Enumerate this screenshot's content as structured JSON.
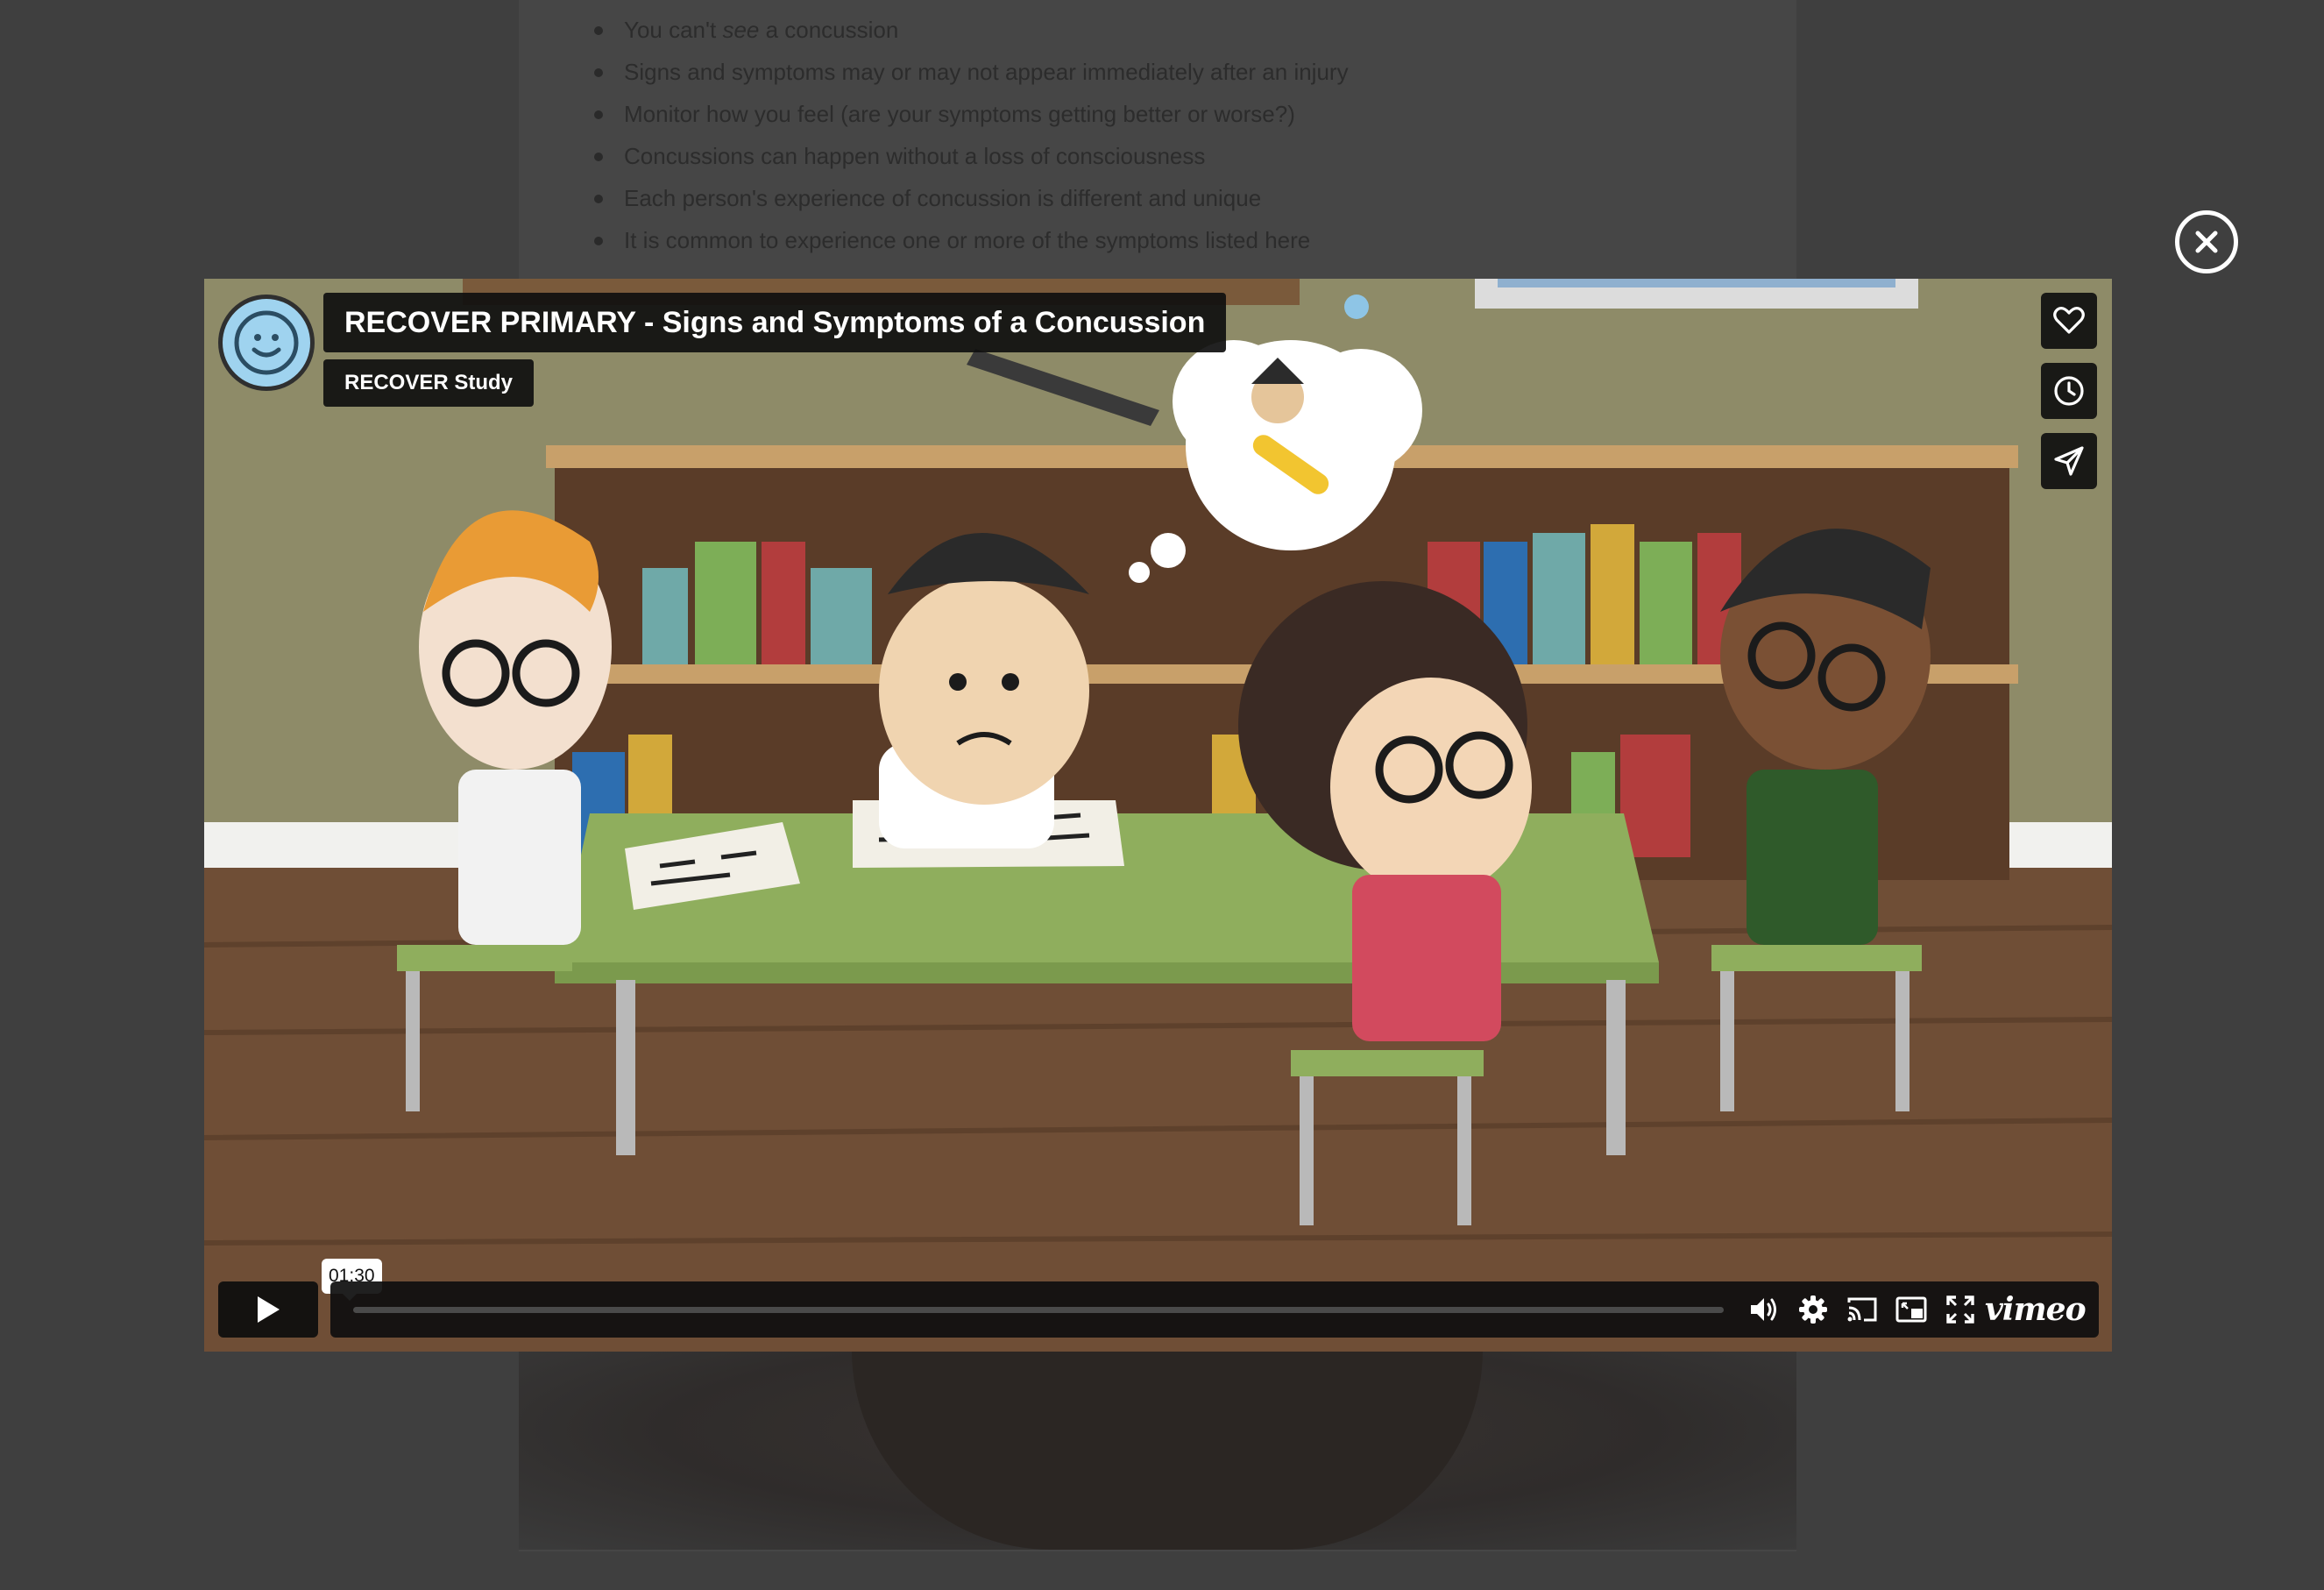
{
  "background_page": {
    "bullets": [
      {
        "before": "You can't ",
        "em": "see",
        "after": " a concussion"
      },
      {
        "before": "Signs and symptoms may or may not appear immediately after an injury",
        "em": "",
        "after": ""
      },
      {
        "before": "Monitor how you feel (are your symptoms getting better or worse?)",
        "em": "",
        "after": ""
      },
      {
        "before": "Concussions can happen without a loss of consciousness",
        "em": "",
        "after": ""
      },
      {
        "before": "Each person's experience of concussion is different and unique",
        "em": "",
        "after": ""
      },
      {
        "before": "It is common to experience one or more of the symptoms listed here",
        "em": "",
        "after": ""
      }
    ]
  },
  "modal": {
    "close_icon": "close-circle-icon"
  },
  "video": {
    "title": "RECOVER PRIMARY - Signs and Symptoms of a Concussion",
    "author": "RECOVER Study",
    "side_actions": [
      "heart-icon",
      "clock-icon",
      "paper-plane-icon"
    ],
    "controls": {
      "play_icon": "play-icon",
      "time_tooltip": "01:30",
      "progress_fraction": 0.0,
      "icons": [
        "volume-icon",
        "gear-icon",
        "cast-icon",
        "picture-in-picture-icon",
        "fullscreen-icon"
      ],
      "brand": "vimeo"
    }
  }
}
